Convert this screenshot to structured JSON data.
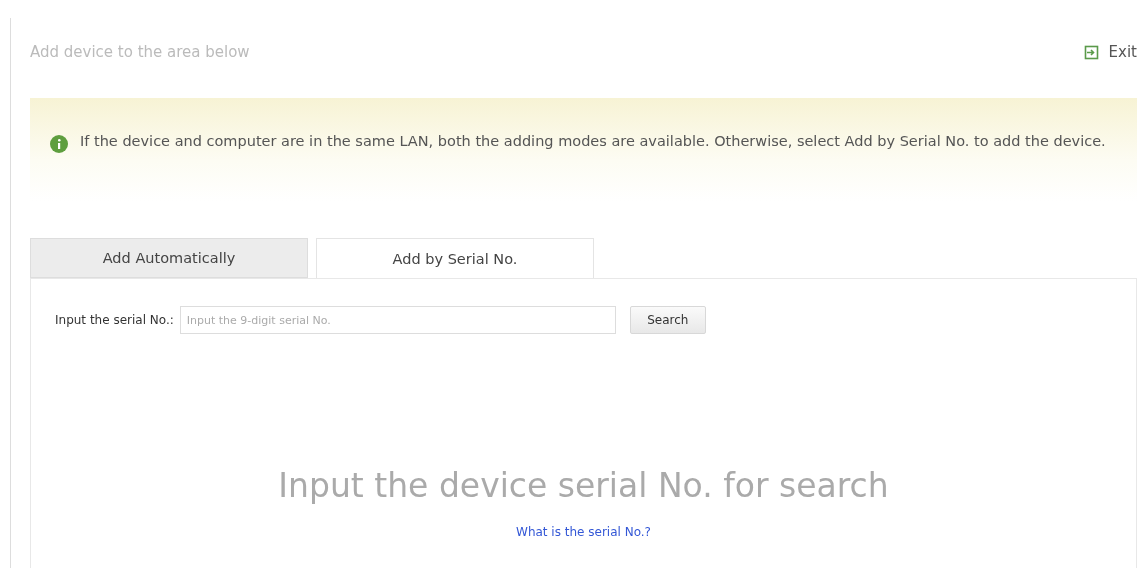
{
  "header": {
    "title": "Add device to the area below",
    "exit": "Exit"
  },
  "notice": {
    "text": "If the device and computer are in the same LAN, both the adding modes are available. Otherwise, select Add by Serial No. to add the device."
  },
  "tabs": [
    {
      "label": "Add Automatically",
      "selected": false
    },
    {
      "label": "Add by Serial No.",
      "selected": true
    }
  ],
  "search": {
    "label": "Input the serial No.:",
    "placeholder": "Input the 9-digit serial No.",
    "button": "Search"
  },
  "empty": {
    "message": "Input the device serial No. for search",
    "link": "What is the serial No.?"
  }
}
